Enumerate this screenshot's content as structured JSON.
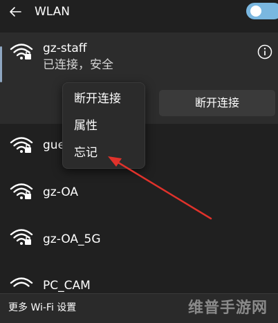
{
  "header": {
    "title": "WLAN",
    "toggle_on": true
  },
  "networks": {
    "connected": {
      "ssid": "gz-staff",
      "status": "已连接，安全",
      "disconnect_label": "断开连接"
    },
    "list": [
      {
        "ssid": "gue"
      },
      {
        "ssid": "gz-OA"
      },
      {
        "ssid": "gz-OA_5G"
      },
      {
        "ssid": "PC_CAM"
      }
    ]
  },
  "context_menu": {
    "items": [
      "断开连接",
      "属性",
      "忘记"
    ]
  },
  "footer": {
    "link": "更多 Wi-Fi 设置",
    "watermark": "维普手游网"
  },
  "colors": {
    "background": "#202020",
    "card": "#2c2c2c",
    "accent": "#7ab7e0",
    "arrow": "#e0322b"
  },
  "icons": {
    "back": "back-arrow-icon",
    "wifi": "wifi-secured-icon",
    "info": "info-icon"
  }
}
